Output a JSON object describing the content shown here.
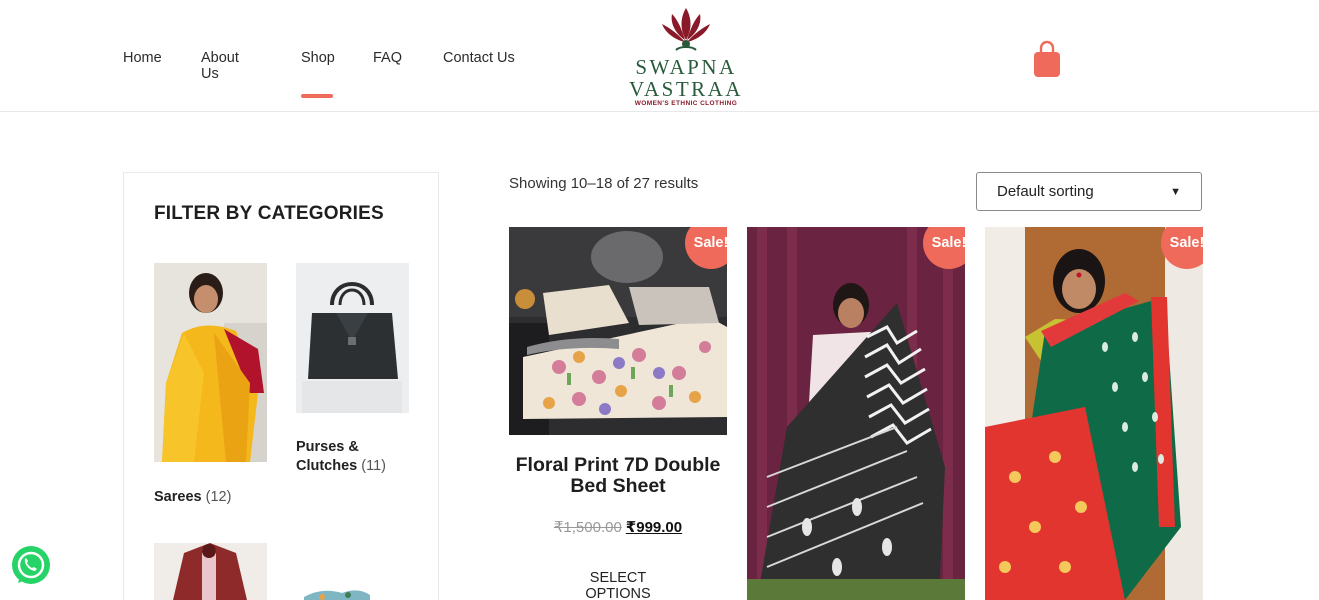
{
  "header": {
    "nav": [
      {
        "label": "Home"
      },
      {
        "label": "About Us"
      },
      {
        "label": "Shop"
      },
      {
        "label": "FAQ"
      },
      {
        "label": "Contact Us"
      }
    ],
    "active_nav": "Shop",
    "logo": {
      "line1": "SWAPNA",
      "line2": "VASTRAA",
      "tagline": "WOMEN'S ETHNIC CLOTHING"
    },
    "cart_icon": "shopping-bag-icon"
  },
  "sidebar": {
    "title": "FILTER BY CATEGORIES",
    "categories": [
      {
        "name": "Sarees",
        "count": "(12)"
      },
      {
        "name": "Purses &",
        "name2": "Clutches",
        "count": "(11)"
      }
    ]
  },
  "results": {
    "count_text": "Showing 10–18 of 27 results",
    "sort_value": "Default sorting"
  },
  "products": [
    {
      "sale_label": "Sale!",
      "title": "Floral Print 7D Double Bed Sheet",
      "old_price": "₹1,500.00",
      "new_price": "₹999.00",
      "action": "SELECT OPTIONS"
    },
    {
      "sale_label": "Sale!"
    },
    {
      "sale_label": "Sale!"
    }
  ],
  "colors": {
    "accent": "#ef6a5a",
    "brand_green": "#2a5a3c",
    "brand_maroon": "#8a1a2a",
    "whatsapp": "#25d366"
  },
  "floating": {
    "icon": "whatsapp-icon"
  }
}
